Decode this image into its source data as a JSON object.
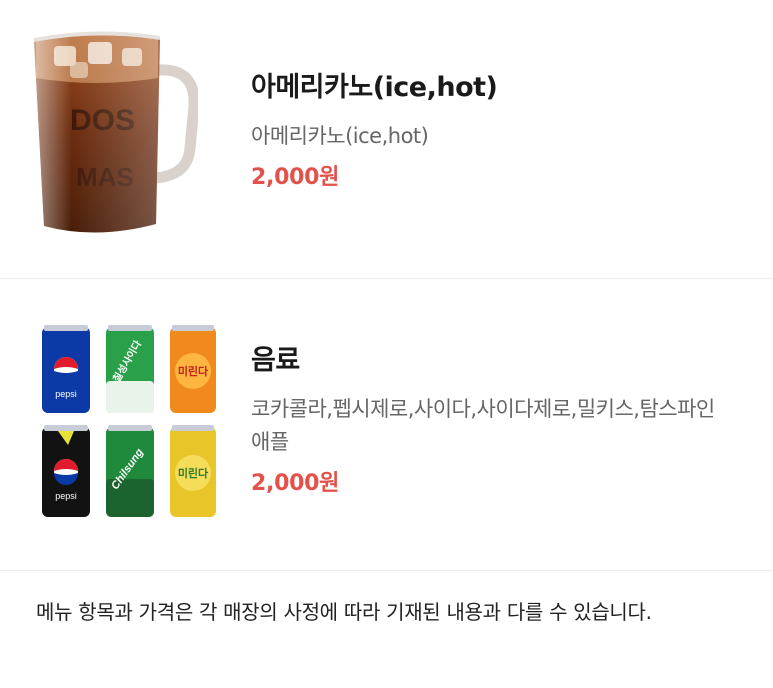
{
  "menu": {
    "items": [
      {
        "name": "아메리카노(ice,hot)",
        "description": "아메리카노(ice,hot)",
        "price": "2,000원",
        "image": "iced-americano-mug-icon"
      },
      {
        "name": "음료",
        "description": "코카콜라,펩시제로,사이다,사이다제로,밀키스,탐스파인애플",
        "price": "2,000원",
        "image": "soda-cans-icon",
        "can_labels": [
          "pepsi",
          "칠성사이다",
          "미린다",
          "pepsi",
          "Chilsung",
          "미린다"
        ]
      }
    ]
  },
  "notice": {
    "text": "메뉴 항목과 가격은 각 매장의 사정에 따라 기재된 내용과 다를 수 있습니다."
  },
  "colors": {
    "price": "#e2524a",
    "divider": "#ececec"
  }
}
